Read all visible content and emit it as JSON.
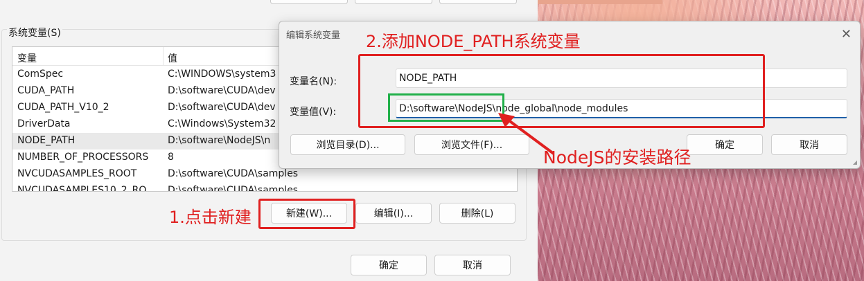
{
  "env_dialog": {
    "system_vars_label": "系统变量(S)",
    "columns": [
      "变量",
      "值"
    ],
    "rows": [
      {
        "name": "ComSpec",
        "value": "C:\\WINDOWS\\system3"
      },
      {
        "name": "CUDA_PATH",
        "value": "D:\\software\\CUDA\\dev"
      },
      {
        "name": "CUDA_PATH_V10_2",
        "value": "D:\\software\\CUDA\\dev"
      },
      {
        "name": "DriverData",
        "value": "C:\\Windows\\System32"
      },
      {
        "name": "NODE_PATH",
        "value": "D:\\software\\NodeJS\\n"
      },
      {
        "name": "NUMBER_OF_PROCESSORS",
        "value": "8"
      },
      {
        "name": "NVCUDASAMPLES_ROOT",
        "value": "D:\\software\\CUDA\\samples"
      },
      {
        "name": "NVCUDASAMPLES10_2_RO",
        "value": "D:\\software\\CUDA\\samples"
      }
    ],
    "new_button": "新建(W)...",
    "edit_button": "编辑(I)...",
    "delete_button": "删除(L)",
    "ok_button": "确定",
    "cancel_button": "取消"
  },
  "edit_dialog": {
    "title": "编辑系统变量",
    "close_icon": "close-icon",
    "name_label": "变量名(N):",
    "name_value": "NODE_PATH",
    "value_label": "变量值(V):",
    "value_value": "D:\\software\\NodeJS\\node_global\\node_modules",
    "browse_dir_button": "浏览目录(D)...",
    "browse_file_button": "浏览文件(F)...",
    "ok_button": "确定",
    "cancel_button": "取消"
  },
  "annotations": {
    "step1": "1.点击新建",
    "step2": "2.添加NODE_PATH系统变量",
    "nodejs_note": "NodeJS的安装路径",
    "red": "#e02020",
    "green": "#21b04a"
  }
}
